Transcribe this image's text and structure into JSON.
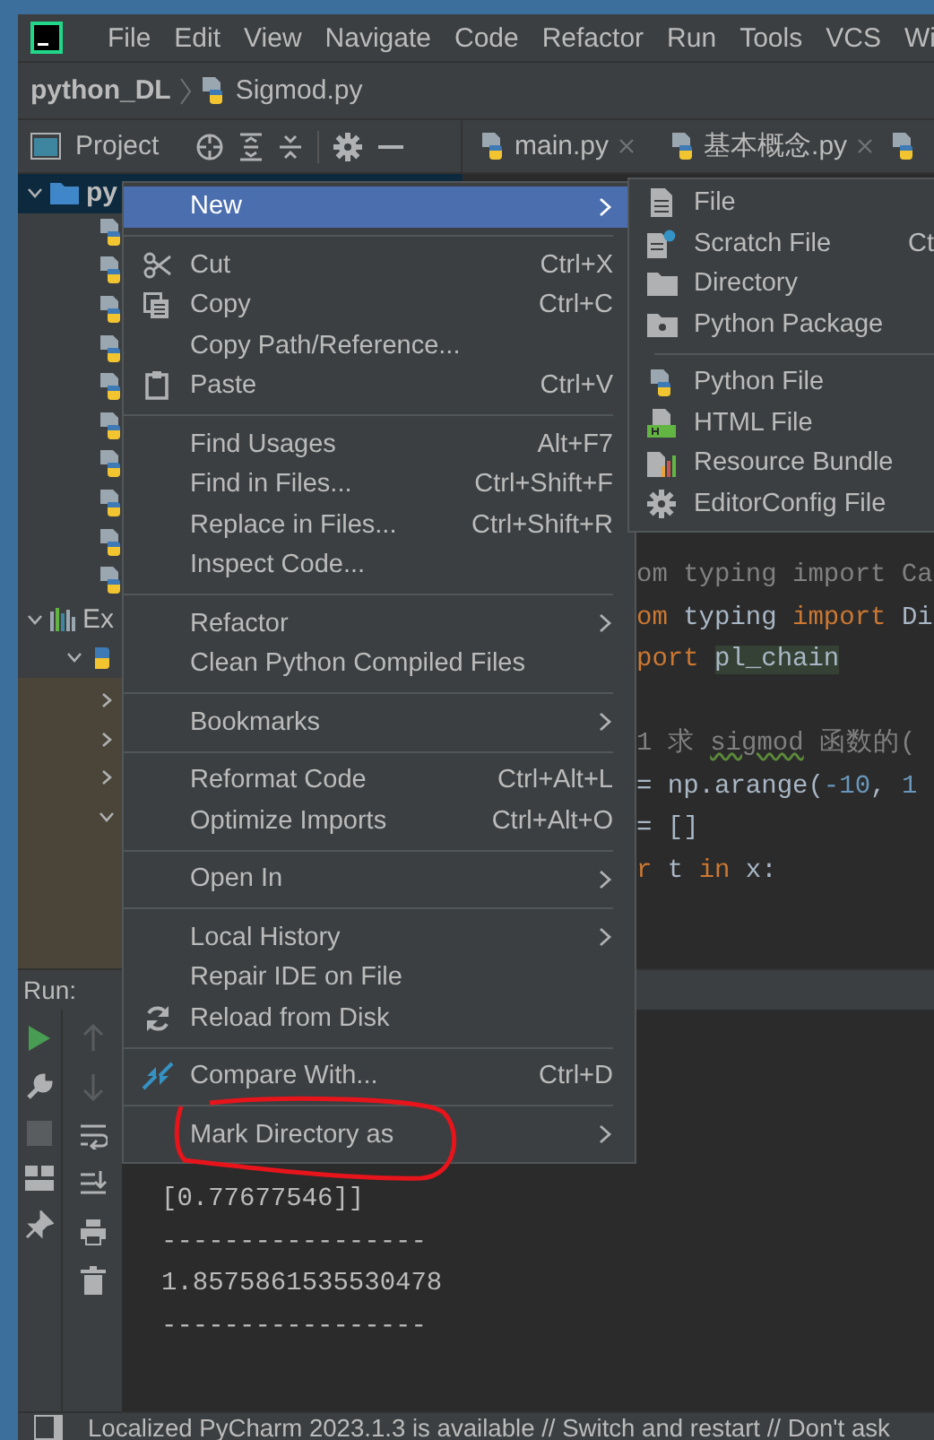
{
  "menu_bar": {
    "items": [
      "File",
      "Edit",
      "View",
      "Navigate",
      "Code",
      "Refactor",
      "Run",
      "Tools",
      "VCS",
      "Wi"
    ]
  },
  "breadcrumb": [
    "python_DL",
    "Sigmod.py"
  ],
  "project_panel": {
    "title": "Project"
  },
  "editor_tabs": [
    {
      "label": "main.py",
      "closable": true
    },
    {
      "label": "基本概念.py",
      "closable": true
    }
  ],
  "tree": [
    {
      "kind": "folder",
      "label": "py",
      "expanded": true,
      "selected": true,
      "children": [
        {
          "kind": "file"
        },
        {
          "kind": "file"
        },
        {
          "kind": "file"
        },
        {
          "kind": "file"
        },
        {
          "kind": "file"
        },
        {
          "kind": "file"
        },
        {
          "kind": "file"
        },
        {
          "kind": "file"
        },
        {
          "kind": "file"
        },
        {
          "kind": "file"
        }
      ]
    },
    {
      "kind": "library",
      "label": "Ex",
      "expanded": true,
      "selected": false,
      "children": [
        {
          "kind": "sdk",
          "expanded": true,
          "children": [
            {
              "kind": "node",
              "expanded": false
            },
            {
              "kind": "node",
              "expanded": false
            },
            {
              "kind": "node",
              "expanded": false
            },
            {
              "kind": "node",
              "expanded": true
            }
          ]
        }
      ]
    }
  ],
  "code_lines": [
    {
      "kind": "code",
      "segments": [
        {
          "text": "om typing import Ca",
          "kind": "unused"
        }
      ]
    },
    {
      "kind": "code",
      "segments": [
        {
          "text": "om",
          "kind": "keyword"
        },
        {
          "text": " typing ",
          "kind": "plain"
        },
        {
          "text": "import",
          "kind": "keyword"
        },
        {
          "text": " Di",
          "kind": "plain"
        }
      ]
    },
    {
      "kind": "code",
      "segments": [
        {
          "text": "port ",
          "kind": "keyword"
        },
        {
          "text": "pl_chain",
          "kind": "highlight"
        }
      ]
    },
    {
      "kind": "blank"
    },
    {
      "kind": "code",
      "segments": [
        {
          "text": "1 求 ",
          "kind": "comment"
        },
        {
          "text": "sigmod",
          "kind": "typo"
        },
        {
          "text": " 函数的(",
          "kind": "comment"
        }
      ]
    },
    {
      "kind": "code",
      "segments": [
        {
          "text": "= np.arange(",
          "kind": "plain"
        },
        {
          "text": "-10",
          "kind": "number"
        },
        {
          "text": ", ",
          "kind": "plain"
        },
        {
          "text": "1",
          "kind": "number"
        }
      ]
    },
    {
      "kind": "code",
      "segments": [
        {
          "text": "= []",
          "kind": "plain"
        }
      ]
    },
    {
      "kind": "code",
      "segments": [
        {
          "text": "r",
          "kind": "keyword"
        },
        {
          "text": " t ",
          "kind": "plain"
        },
        {
          "text": "in",
          "kind": "keyword"
        },
        {
          "text": " x:",
          "kind": "plain"
        }
      ]
    }
  ],
  "run_panel": {
    "title": "Run:",
    "console": [
      "[0.77677546]]",
      "-----------------",
      "1.8575861535530478",
      "-----------------"
    ]
  },
  "status_bar": "Localized PyCharm 2023.1.3 is available // Switch and restart // Don't ask",
  "context_menu": {
    "sections": [
      [
        {
          "label": "New",
          "submenu": true,
          "selected": true
        }
      ],
      [
        {
          "label": "Cut",
          "shortcut": "Ctrl+X",
          "selected": false
        },
        {
          "label": "Copy",
          "shortcut": "Ctrl+C",
          "selected": false
        },
        {
          "label": "Copy Path/Reference...",
          "selected": false
        },
        {
          "label": "Paste",
          "shortcut": "Ctrl+V",
          "selected": false
        }
      ],
      [
        {
          "label": "Find Usages",
          "shortcut": "Alt+F7",
          "selected": false
        },
        {
          "label": "Find in Files...",
          "shortcut": "Ctrl+Shift+F",
          "selected": false
        },
        {
          "label": "Replace in Files...",
          "shortcut": "Ctrl+Shift+R",
          "selected": false
        },
        {
          "label": "Inspect Code...",
          "selected": false
        }
      ],
      [
        {
          "label": "Refactor",
          "submenu": true,
          "selected": false
        },
        {
          "label": "Clean Python Compiled Files",
          "selected": false
        }
      ],
      [
        {
          "label": "Bookmarks",
          "submenu": true,
          "selected": false
        }
      ],
      [
        {
          "label": "Reformat Code",
          "shortcut": "Ctrl+Alt+L",
          "selected": false
        },
        {
          "label": "Optimize Imports",
          "shortcut": "Ctrl+Alt+O",
          "selected": false
        }
      ],
      [
        {
          "label": "Open In",
          "submenu": true,
          "selected": false
        }
      ],
      [
        {
          "label": "Local History",
          "submenu": true,
          "selected": false
        },
        {
          "label": "Repair IDE on File",
          "selected": false
        },
        {
          "label": "Reload from Disk",
          "selected": false
        }
      ],
      [
        {
          "label": "Compare With...",
          "shortcut": "Ctrl+D",
          "selected": false
        }
      ],
      [
        {
          "label": "Mark Directory as",
          "submenu": true,
          "selected": false
        }
      ]
    ]
  },
  "submenu": {
    "sections": [
      [
        {
          "label": "File"
        },
        {
          "label": "Scratch File",
          "shortcut": "Ct"
        },
        {
          "label": "Directory"
        },
        {
          "label": "Python Package"
        }
      ],
      [
        {
          "label": "Python File"
        },
        {
          "label": "HTML File"
        },
        {
          "label": "Resource Bundle"
        },
        {
          "label": "EditorConfig File"
        }
      ]
    ]
  },
  "annotation": {
    "kind": "ellipse"
  }
}
